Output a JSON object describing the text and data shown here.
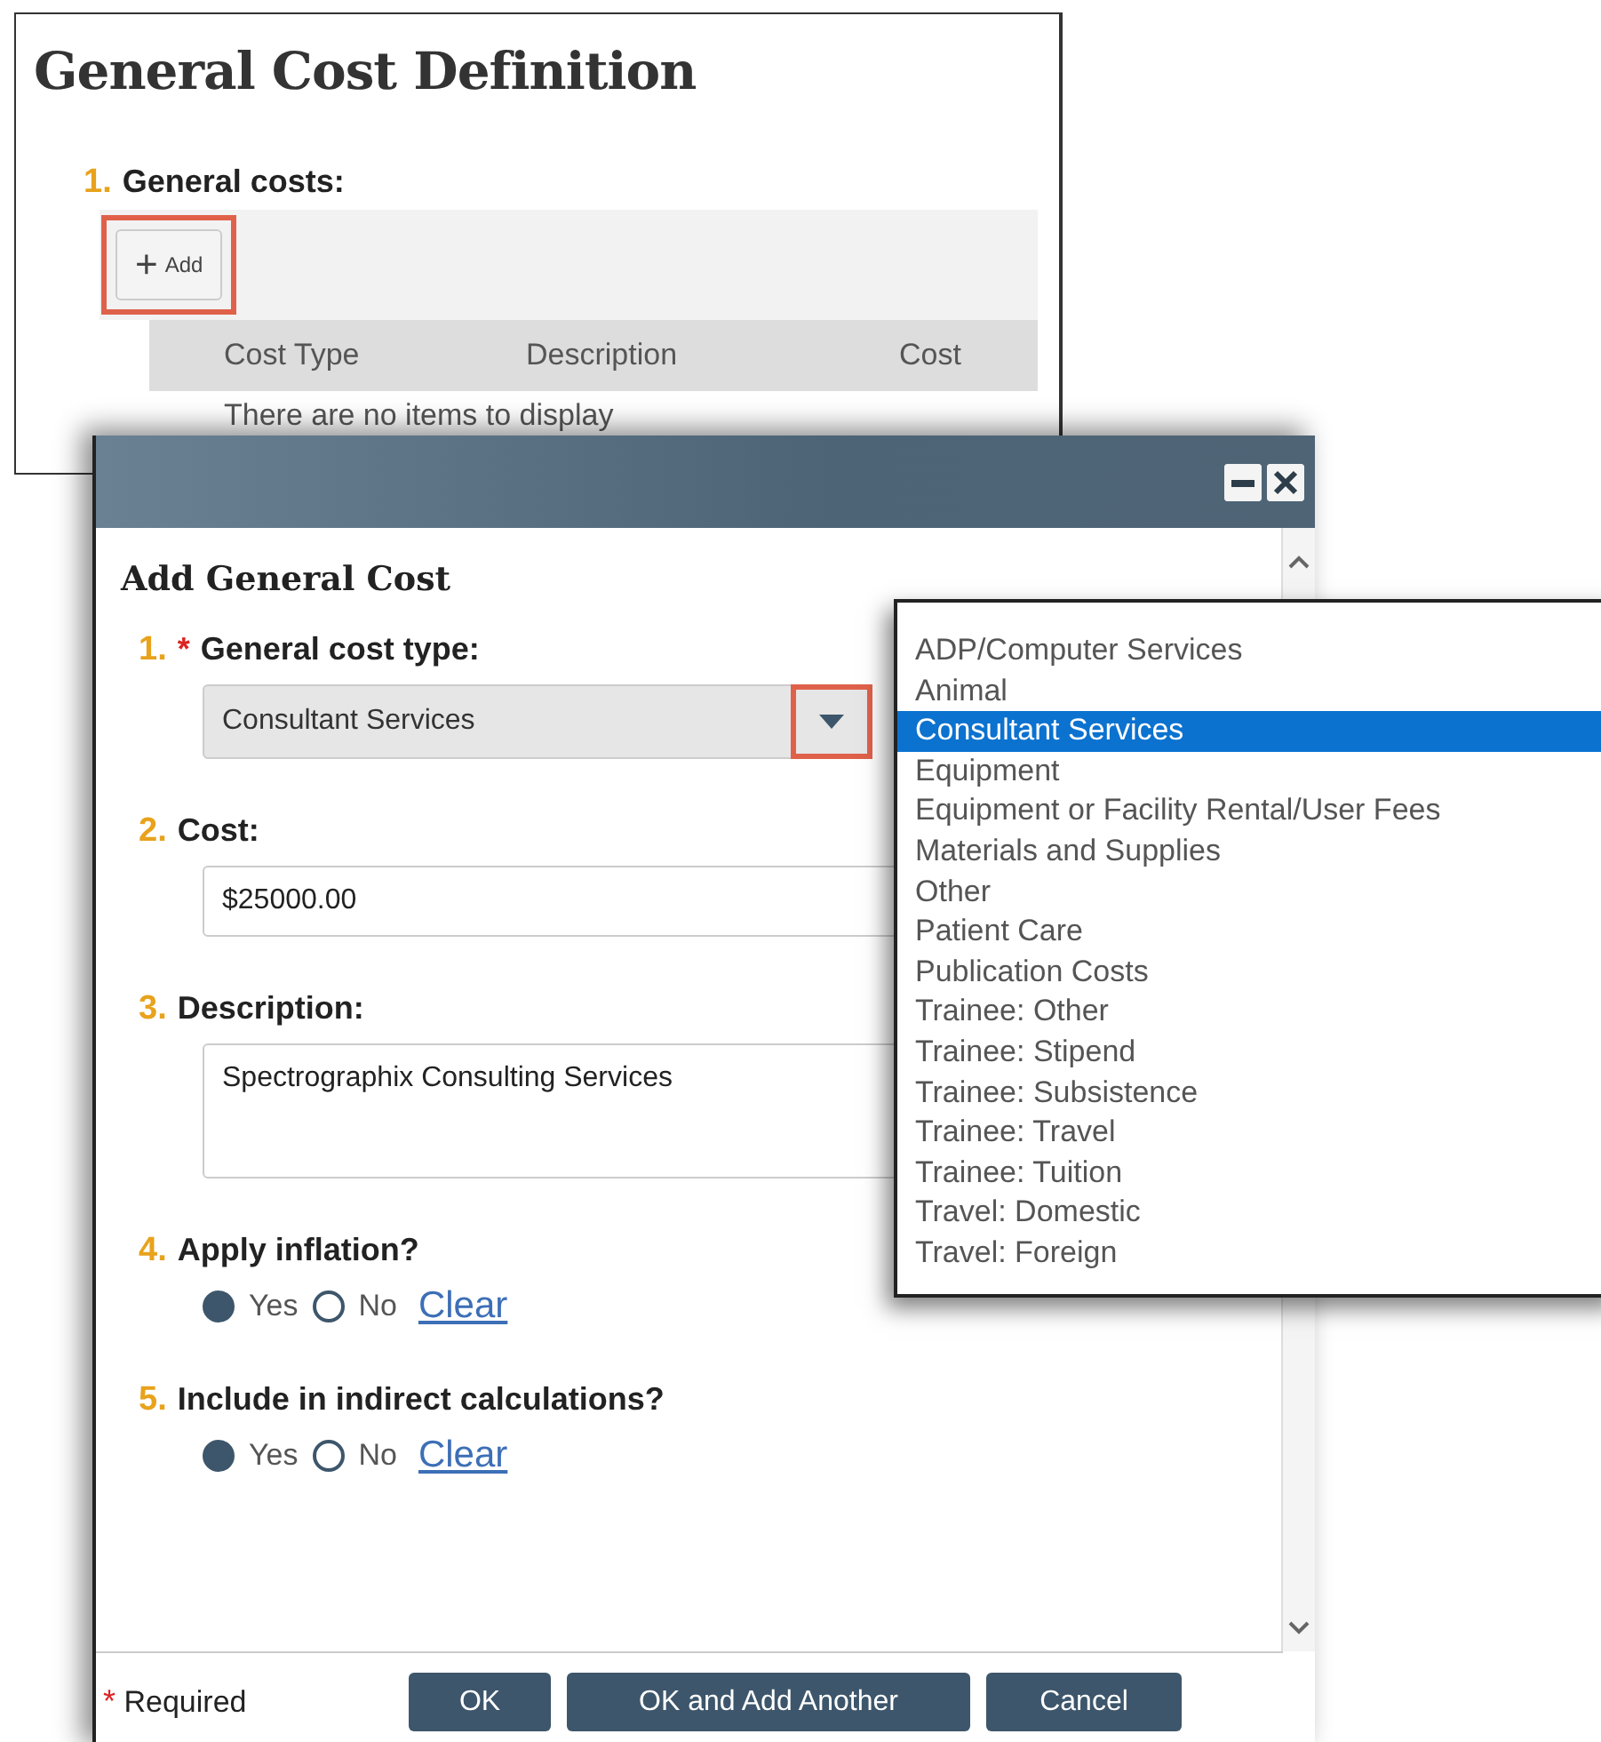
{
  "page": {
    "title": "General Cost Definition",
    "section": {
      "number": "1.",
      "label": "General costs:",
      "add_button": {
        "icon": "+",
        "label": "Add",
        "highlighted": true
      },
      "columns": [
        "Cost Type",
        "Description",
        "Cost"
      ],
      "empty_message": "There are no items to display"
    }
  },
  "dialog": {
    "title": "Add General Cost",
    "required_marker": "*",
    "questions": [
      {
        "kind": "select",
        "number": "1.",
        "required": true,
        "label": "General cost type:",
        "value": "Consultant Services",
        "arrow_highlighted": true
      },
      {
        "kind": "text",
        "number": "2.",
        "required": false,
        "label": "Cost:",
        "value": "$25000.00"
      },
      {
        "kind": "textarea",
        "number": "3.",
        "required": false,
        "label": "Description:",
        "value": "Spectrographix Consulting Services"
      },
      {
        "kind": "radio",
        "number": "4.",
        "required": false,
        "label": "Apply inflation?",
        "options": [
          {
            "label": "Yes",
            "selected": true
          },
          {
            "label": "No",
            "selected": false
          }
        ],
        "clear_link": "Clear"
      },
      {
        "kind": "radio",
        "number": "5.",
        "required": false,
        "label": "Include in indirect calculations?",
        "options": [
          {
            "label": "Yes",
            "selected": true
          },
          {
            "label": "No",
            "selected": false
          }
        ],
        "clear_link": "Clear"
      }
    ],
    "required_note": "Required",
    "buttons": [
      "OK",
      "OK and Add Another",
      "Cancel"
    ]
  },
  "dropdown": {
    "options": [
      {
        "label": "ADP/Computer Services",
        "selected": false
      },
      {
        "label": "Animal",
        "selected": false
      },
      {
        "label": "Consultant Services",
        "selected": true
      },
      {
        "label": "Equipment",
        "selected": false
      },
      {
        "label": "Equipment or Facility Rental/User Fees",
        "selected": false
      },
      {
        "label": "Materials and Supplies",
        "selected": false
      },
      {
        "label": "Other",
        "selected": false
      },
      {
        "label": "Patient Care",
        "selected": false
      },
      {
        "label": "Publication Costs",
        "selected": false
      },
      {
        "label": "Trainee: Other",
        "selected": false
      },
      {
        "label": "Trainee: Stipend",
        "selected": false
      },
      {
        "label": "Trainee: Subsistence",
        "selected": false
      },
      {
        "label": "Trainee: Travel",
        "selected": false
      },
      {
        "label": "Trainee: Tuition",
        "selected": false
      },
      {
        "label": "Travel: Domestic",
        "selected": false
      },
      {
        "label": "Travel: Foreign",
        "selected": false
      }
    ]
  }
}
